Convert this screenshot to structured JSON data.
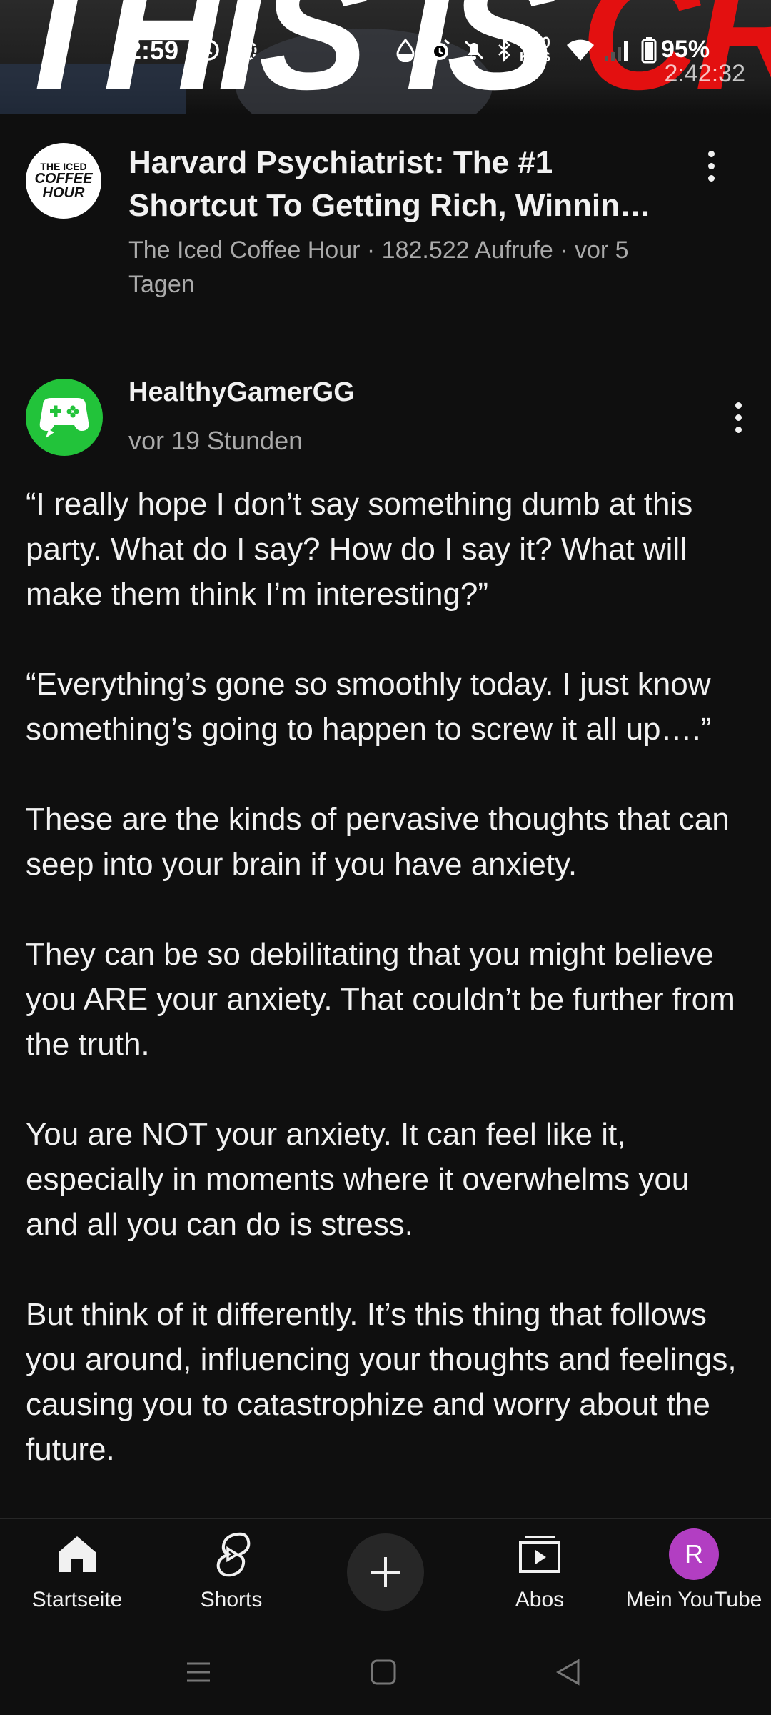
{
  "status_bar": {
    "clock": "12:59",
    "speed_value": "2,00",
    "speed_unit": "KB/S",
    "battery": "95%",
    "icons": [
      "whatsapp-icon",
      "signal-app-icon",
      "data-saver-icon",
      "alarm-icon",
      "mute-icon",
      "bluetooth-icon",
      "wifi-icon",
      "cell-signal-icon",
      "battery-icon"
    ]
  },
  "thumbnail": {
    "text_white": "THIS IS",
    "text_red": "CRAZY!",
    "duration": "2:42:32"
  },
  "video": {
    "channel_logo_line1": "THE ICED",
    "channel_logo_line2": "COFFEE",
    "channel_logo_line3": "HOUR",
    "title": "Harvard Psychiatrist: The #1 Shortcut To Getting Rich, Winnin…",
    "meta": "The Iced Coffee Hour · 182.522 Aufrufe · vor 5 Tagen"
  },
  "post": {
    "channel": "HealthyGamerGG",
    "time": "vor 19 Stunden",
    "paragraphs": [
      "“I really hope I don’t say something dumb at this party. What do I say? How do I say it? What will make them think I’m interesting?”",
      "“Everything’s gone so smoothly today. I just know something’s going to happen to screw it all up….”",
      "These are the kinds of pervasive thoughts that can seep into your brain if you have anxiety.",
      "They can be so debilitating that you might believe you ARE your anxiety. That couldn’t be further from the truth.",
      "You are NOT your anxiety. It can feel like it, especially in moments where it overwhelms you and all you can do is stress.",
      "But think of it differently. It’s this thing that follows you around, influencing your thoughts and feelings, causing you to catastrophize and worry about the future."
    ]
  },
  "bottom_nav": {
    "home": "Startseite",
    "shorts": "Shorts",
    "subscriptions": "Abos",
    "library": "Mein YouTube",
    "avatar_letter": "R"
  },
  "colors": {
    "background": "#0f0f0f",
    "text_primary": "#f1f1f1",
    "text_secondary": "#aaaaaa",
    "avatar_green": "#22c33a",
    "avatar_purple": "#b23ec2"
  }
}
